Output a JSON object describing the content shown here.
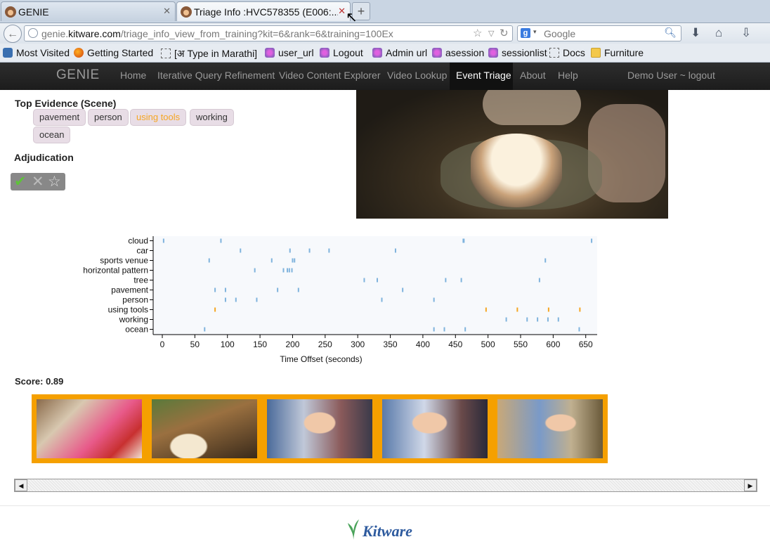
{
  "browser": {
    "tabs": [
      {
        "title": "GENIE",
        "close": "✕"
      },
      {
        "title": "Triage Info :HVC578355 (E006:...",
        "close": "✕"
      }
    ],
    "new_tab": "+",
    "url_domain": "genie.",
    "url_host": "kitware.com",
    "url_path": "/triage_info_view_from_training?kit=6&rank=6&training=100Ex",
    "search_placeholder": "Google",
    "bookmarks": [
      {
        "label": "Most Visited",
        "icon": "star-icon"
      },
      {
        "label": "Getting Started",
        "icon": "firefox-icon"
      },
      {
        "label": "[अ Type in Marathi]",
        "icon": "page-icon"
      },
      {
        "label": "user_url",
        "icon": "bookmark-tree-icon"
      },
      {
        "label": "Logout",
        "icon": "bookmark-tree-icon"
      },
      {
        "label": "Admin url",
        "icon": "bookmark-tree-icon"
      },
      {
        "label": "asession",
        "icon": "bookmark-tree-icon"
      },
      {
        "label": "sessionlist",
        "icon": "bookmark-tree-icon"
      },
      {
        "label": "Docs",
        "icon": "page-icon"
      },
      {
        "label": "Furniture",
        "icon": "folder-icon"
      }
    ]
  },
  "app": {
    "brand": "GENIE",
    "nav": [
      {
        "label": "Home",
        "active": false
      },
      {
        "label": "Iterative Query Refinement",
        "active": false
      },
      {
        "label": "Video Content Explorer",
        "active": false
      },
      {
        "label": "Video Lookup",
        "active": false
      },
      {
        "label": "Event Triage",
        "active": true
      },
      {
        "label": "About",
        "active": false
      },
      {
        "label": "Help",
        "active": false
      }
    ],
    "user": "Demo User ~ logout"
  },
  "evidence": {
    "heading": "Top Evidence (Scene)",
    "tags": [
      {
        "label": "pavement",
        "highlighted": false
      },
      {
        "label": "person",
        "highlighted": false
      },
      {
        "label": "using tools",
        "highlighted": true
      },
      {
        "label": "working",
        "highlighted": false
      },
      {
        "label": "ocean",
        "highlighted": false
      }
    ],
    "highlight_color": "#f5a623"
  },
  "adjudication": {
    "heading": "Adjudication",
    "accept": "✔",
    "reject": "✕",
    "star": "☆"
  },
  "chart_data": {
    "type": "scatter",
    "xlabel": "Time Offset (seconds)",
    "xlim": [
      0,
      660
    ],
    "xticks": [
      0,
      50,
      100,
      150,
      200,
      250,
      300,
      350,
      400,
      450,
      500,
      550,
      600,
      650
    ],
    "categories": [
      "cloud",
      "car",
      "sports venue",
      "horizontal pattern",
      "tree",
      "pavement",
      "person",
      "using tools",
      "working",
      "ocean"
    ],
    "series": [
      {
        "category": "cloud",
        "times": [
          2,
          90,
          462,
          463,
          659
        ],
        "color": "#7fb3dd"
      },
      {
        "category": "car",
        "times": [
          120,
          196,
          226,
          256,
          358
        ],
        "color": "#7fb3dd"
      },
      {
        "category": "sports venue",
        "times": [
          72,
          168,
          200,
          203,
          588
        ],
        "color": "#7fb3dd"
      },
      {
        "category": "horizontal pattern",
        "times": [
          142,
          186,
          192,
          195,
          199
        ],
        "color": "#7fb3dd"
      },
      {
        "category": "tree",
        "times": [
          310,
          330,
          435,
          459,
          579
        ],
        "color": "#7fb3dd"
      },
      {
        "category": "pavement",
        "times": [
          81,
          97,
          177,
          209,
          369
        ],
        "color": "#7fb3dd"
      },
      {
        "category": "person",
        "times": [
          97,
          113,
          145,
          337,
          417
        ],
        "color": "#7fb3dd"
      },
      {
        "category": "using tools",
        "times": [
          81,
          497,
          545,
          593,
          641
        ],
        "color": "#f5a623"
      },
      {
        "category": "working",
        "times": [
          528,
          560,
          576,
          592,
          608
        ],
        "color": "#7fb3dd"
      },
      {
        "category": "ocean",
        "times": [
          65,
          417,
          433,
          465,
          640
        ],
        "color": "#7fb3dd"
      }
    ]
  },
  "score": {
    "label": "Score: 0.89"
  },
  "thumbnails": {
    "border_color": "#f5a000",
    "items": [
      {
        "icon": "video-frame-gifts"
      },
      {
        "icon": "video-frame-cake"
      },
      {
        "icon": "video-frame-baby"
      },
      {
        "icon": "video-frame-baby"
      },
      {
        "icon": "video-frame-baby-chair"
      }
    ]
  },
  "footer": {
    "logo": "Kitware"
  }
}
